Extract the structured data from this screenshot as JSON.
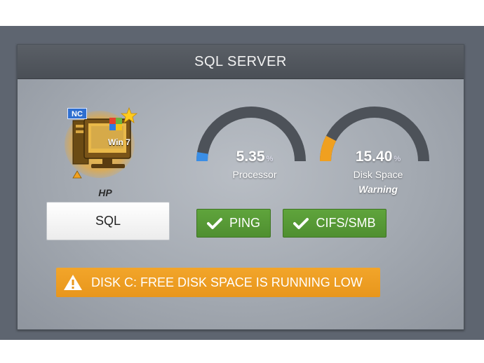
{
  "header": {
    "title": "SQL SERVER"
  },
  "device": {
    "badge": "NC",
    "os_label": "Win 7",
    "vendor": "HP",
    "name_button": "SQL"
  },
  "gauges": [
    {
      "value": "5.35",
      "unit": "%",
      "percent": 5.35,
      "label": "Processor",
      "status": "",
      "color": "#3a8ee6"
    },
    {
      "value": "15.40",
      "unit": "%",
      "percent": 15.4,
      "label": "Disk Space",
      "status": "Warning",
      "color": "#f0a020"
    }
  ],
  "checks": [
    {
      "label": "PING",
      "status": "ok"
    },
    {
      "label": "CIFS/SMB",
      "status": "ok"
    }
  ],
  "alert": {
    "message": "DISK C: FREE DISK SPACE IS RUNNING LOW"
  },
  "colors": {
    "ok_green": "#5fa43c",
    "warning_orange": "#f0a020",
    "processor_blue": "#3a8ee6",
    "gauge_track": "#4d5259"
  }
}
